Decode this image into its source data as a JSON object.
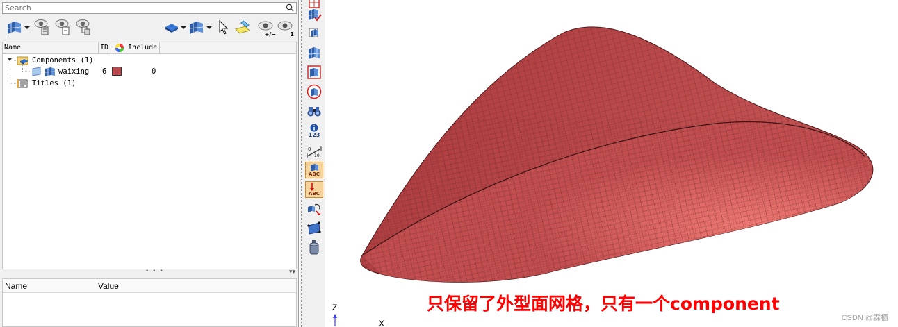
{
  "search": {
    "placeholder": "Search"
  },
  "toolbar": {
    "icons": [
      "component-view-icon",
      "eye-show-icon",
      "eye-hide-icon",
      "eye-isolate-icon",
      "solid-mode-icon",
      "display-mode-icon",
      "cursor-icon",
      "highlight-icon",
      "eye-toggle-icon",
      "eye-one-icon"
    ],
    "eye_toggle_caption": "+/−",
    "eye_one_caption": "1"
  },
  "tree": {
    "columns": {
      "name": "Name",
      "id": "ID",
      "include": "Include"
    },
    "components": {
      "label": "Components (1)"
    },
    "items": [
      {
        "name": "waixing",
        "id": "6",
        "color": "#b8484c",
        "include": "0"
      }
    ],
    "titles": {
      "label": "Titles (1)"
    }
  },
  "properties": {
    "columns": {
      "name": "Name",
      "value": "Value"
    }
  },
  "vtoolbar": {
    "icons": [
      "mesh-red-icon",
      "mesh-check-icon",
      "mesh-edit-icon",
      "mesh-grid-icon",
      "mesh-red-frame-icon",
      "mesh-circle-icon",
      "binoculars-icon",
      "info-123-icon",
      "measure-icon",
      "label-abc-icon",
      "label-abc-arrow-icon",
      "transform-icon",
      "plane-icon",
      "cylinder-icon"
    ],
    "info_caption": "123",
    "abc_caption": "ABC"
  },
  "viewport": {
    "caption": "只保留了外型面网格，只有一个component",
    "axis_z": "Z",
    "axis_x": "X",
    "watermark": "CSDN @霖栖",
    "mesh_color": "#b8484c"
  }
}
